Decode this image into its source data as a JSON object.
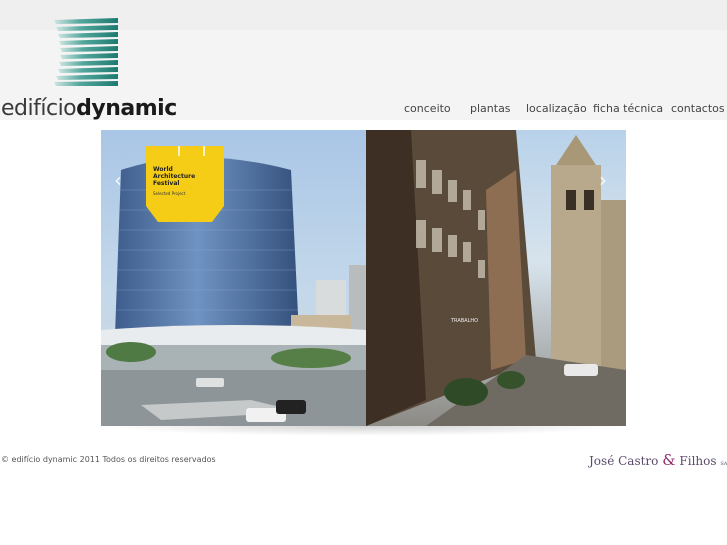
{
  "brand": {
    "light": "edifício",
    "bold": "dynamic"
  },
  "nav": [
    "conceito",
    "plantas",
    "localização",
    "ficha técnica",
    "contactos"
  ],
  "slideshow": {
    "badge_title": "World Architecture Festival",
    "badge_sub": "Selected Project",
    "prev_icon": "‹",
    "next_icon": "›",
    "sign_text": "TRABALHO"
  },
  "footer": {
    "copyright": "©  edifício dynamic 2011 Todos os direitos reservados",
    "company_a": "José Castro",
    "company_amp": "&",
    "company_b": "Filhos",
    "company_sa": "SA"
  },
  "colors": {
    "logo_teal": "#2a8c82",
    "badge_yellow": "#f5cc16",
    "company_purple": "#5b4a6a"
  }
}
